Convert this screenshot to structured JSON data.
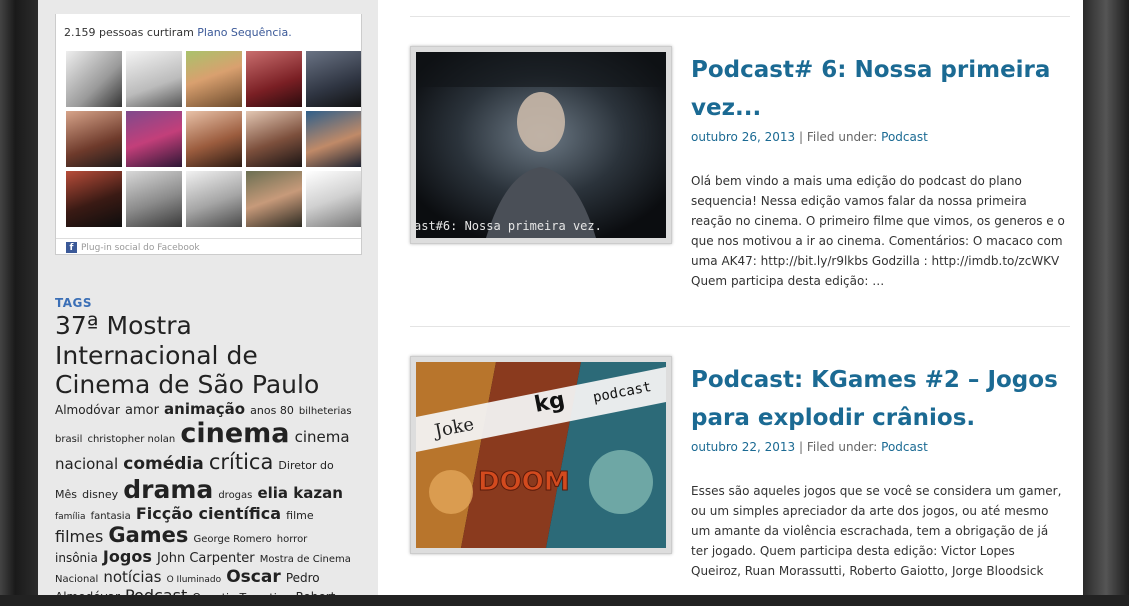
{
  "facebook": {
    "likes_text": "2.159 pessoas curtiram",
    "page_link": "Plano Sequência.",
    "plugin_text": "Plug-in social do Facebook"
  },
  "tags": {
    "title": "TAGS",
    "items": [
      {
        "label": "37ª Mostra Internacional de Cinema de São Paulo",
        "size": 25
      },
      {
        "label": "Almodóvar",
        "size": 12
      },
      {
        "label": "amor",
        "size": 13
      },
      {
        "label": "animação",
        "size": 15,
        "bold": true
      },
      {
        "label": "anos 80",
        "size": 11
      },
      {
        "label": "bilheterias",
        "size": 10
      },
      {
        "label": "brasil",
        "size": 10
      },
      {
        "label": "christopher nolan",
        "size": 10
      },
      {
        "label": "cinema",
        "size": 27,
        "bold": true
      },
      {
        "label": "cinema nacional",
        "size": 15
      },
      {
        "label": "comédia",
        "size": 17,
        "bold": true
      },
      {
        "label": "crítica",
        "size": 21
      },
      {
        "label": "Diretor do Mês",
        "size": 11
      },
      {
        "label": "disney",
        "size": 11
      },
      {
        "label": "drama",
        "size": 25,
        "bold": true
      },
      {
        "label": "drogas",
        "size": 10
      },
      {
        "label": "elia kazan",
        "size": 15,
        "bold": true
      },
      {
        "label": "família",
        "size": 9
      },
      {
        "label": "fantasia",
        "size": 10
      },
      {
        "label": "Ficção científica",
        "size": 16,
        "bold": true
      },
      {
        "label": "filme",
        "size": 11
      },
      {
        "label": "filmes",
        "size": 16
      },
      {
        "label": "Games",
        "size": 21,
        "bold": true
      },
      {
        "label": "George Romero",
        "size": 10
      },
      {
        "label": "horror",
        "size": 10
      },
      {
        "label": "insônia",
        "size": 12
      },
      {
        "label": "Jogos",
        "size": 16,
        "bold": true
      },
      {
        "label": "John Carpenter",
        "size": 13
      },
      {
        "label": "Mostra de Cinema Nacional",
        "size": 10
      },
      {
        "label": "notícias",
        "size": 15
      },
      {
        "label": "O Iluminado",
        "size": 9
      },
      {
        "label": "Oscar",
        "size": 17,
        "bold": true
      },
      {
        "label": "Pedro Almodóvar",
        "size": 12
      },
      {
        "label": "Podcast",
        "size": 16
      },
      {
        "label": "Quentin Tarantino",
        "size": 11
      },
      {
        "label": "Robert",
        "size": 12
      }
    ]
  },
  "posts": [
    {
      "title": "Podcast# 6: Nossa primeira vez...",
      "date": "outubro 26, 2013",
      "filed": "| Filed under:",
      "category": "Podcast",
      "excerpt": "Olá bem vindo a mais uma edição do podcast do plano sequencia! Nessa edição vamos falar da nossa primeira reação no cinema. O primeiro filme que vimos, os generos e o que nos motivou a ir ao cinema. Comentários: O macaco com uma AK47: http://bit.ly/r9lkbs Godzilla : http://imdb.to/zcWKV Quem participa desta edição: …",
      "thumb_caption": "ast#6: Nossa primeira vez."
    },
    {
      "title": "Podcast: KGames #2 – Jogos para explodir crânios.",
      "date": "outubro 22, 2013",
      "filed": "| Filed under:",
      "category": "Podcast",
      "excerpt": "Esses são aqueles jogos que se você se considera um gamer, ou um simples apreciador da arte dos jogos, ou até mesmo um amante da violência escrachada, tem a obrigação de já ter jogado.   Quem participa desta edição: Victor Lopes Queiroz, Ruan Morassutti, Roberto Gaiotto, Jorge Bloodsick",
      "thumb_texts": [
        "Joke",
        "kg",
        "podcast",
        "DOOM"
      ]
    }
  ],
  "colors": {
    "link": "#1b6a93",
    "tags_title": "#3b6fb6",
    "facebook": "#3b5998"
  }
}
